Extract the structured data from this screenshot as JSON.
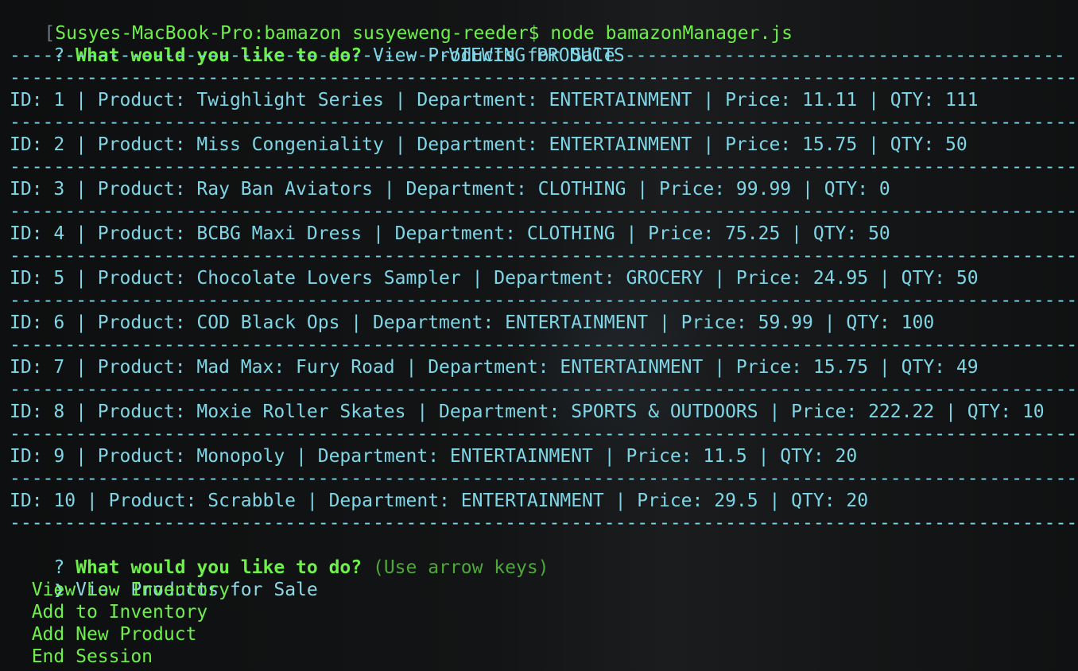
{
  "shell": {
    "prompt_bracket": "[",
    "prompt": "Susyes-MacBook-Pro:bamazon susyeweng-reeder$",
    "command": " node bamazonManager.js"
  },
  "question1": {
    "mark": "? ",
    "text": "What would you like to do?",
    "answer": " View Products for Sale"
  },
  "header": {
    "title": "VIEWING PRODUCTS"
  },
  "separator": "-------------------------------------------------------------------------------------------------------------------------------------------------",
  "products": [
    {
      "line": "ID: 1 | Product: Twighlight Series | Department: ENTERTAINMENT | Price: 11.11 | QTY: 111"
    },
    {
      "line": "ID: 2 | Product: Miss Congeniality | Department: ENTERTAINMENT | Price: 15.75 | QTY: 50"
    },
    {
      "line": "ID: 3 | Product: Ray Ban Aviators | Department: CLOTHING | Price: 99.99 | QTY: 0"
    },
    {
      "line": "ID: 4 | Product: BCBG Maxi Dress | Department: CLOTHING | Price: 75.25 | QTY: 50"
    },
    {
      "line": "ID: 5 | Product: Chocolate Lovers Sampler | Department: GROCERY | Price: 24.95 | QTY: 50"
    },
    {
      "line": "ID: 6 | Product: COD Black Ops | Department: ENTERTAINMENT | Price: 59.99 | QTY: 100"
    },
    {
      "line": "ID: 7 | Product: Mad Max: Fury Road | Department: ENTERTAINMENT | Price: 15.75 | QTY: 49"
    },
    {
      "line": "ID: 8 | Product: Moxie Roller Skates | Department: SPORTS & OUTDOORS | Price: 222.22 | QTY: 10"
    },
    {
      "line": "ID: 9 | Product: Monopoly | Department: ENTERTAINMENT | Price: 11.5 | QTY: 20"
    },
    {
      "line": "ID: 10 | Product: Scrabble | Department: ENTERTAINMENT | Price: 29.5 | QTY: 20"
    }
  ],
  "question2": {
    "mark": "? ",
    "text": "What would you like to do?",
    "hint": " (Use arrow keys)"
  },
  "menu": {
    "pointer": "❯ ",
    "selected": "View Products for Sale",
    "options": [
      "View Low Inventory",
      "Add to Inventory",
      "Add New Product",
      "End Session"
    ]
  }
}
